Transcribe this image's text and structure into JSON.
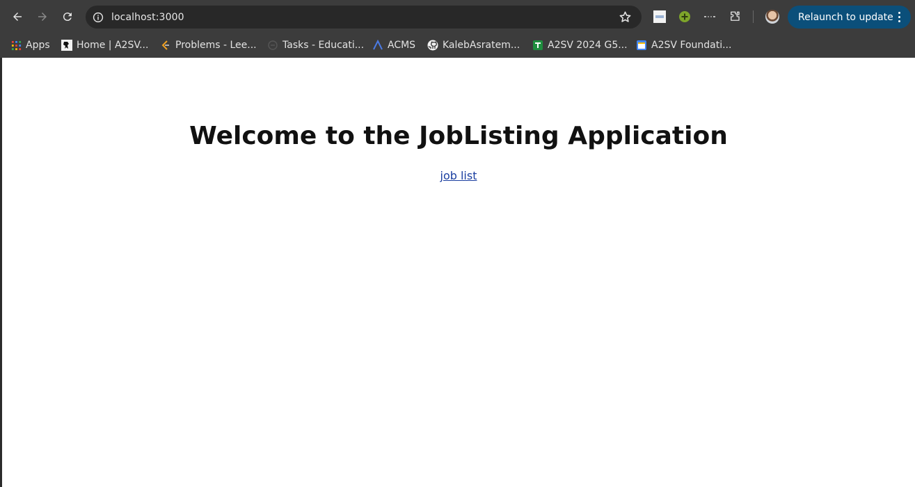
{
  "browser": {
    "url": "localhost:3000",
    "relaunch_label": "Relaunch to update",
    "accent_color": "#0b4f7a"
  },
  "bookmarks": [
    {
      "label": "Apps",
      "icon": "apps-grid-icon"
    },
    {
      "label": "Home | A2SV...",
      "icon": "a2sv-icon"
    },
    {
      "label": "Problems - Lee...",
      "icon": "leetcode-icon"
    },
    {
      "label": "Tasks - Educati...",
      "icon": "tasks-icon"
    },
    {
      "label": "ACMS",
      "icon": "acms-icon"
    },
    {
      "label": "KalebAsratem...",
      "icon": "github-icon"
    },
    {
      "label": "A2SV 2024 G5...",
      "icon": "sheets-icon"
    },
    {
      "label": "A2SV Foundati...",
      "icon": "calendar-icon"
    }
  ],
  "page": {
    "heading": "Welcome to the JobListing Application",
    "link_text": "job list"
  }
}
